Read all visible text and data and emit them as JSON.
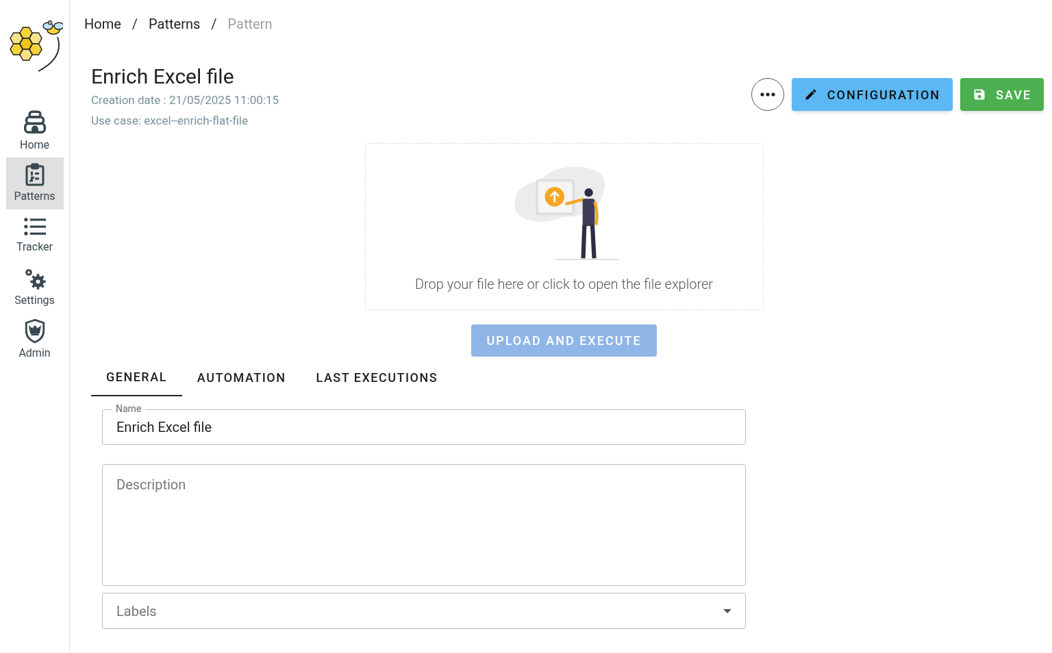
{
  "sidebar": {
    "items": [
      {
        "kind": "hive",
        "label": "Home",
        "selected": false
      },
      {
        "kind": "clipboard",
        "label": "Patterns",
        "selected": true
      },
      {
        "kind": "list",
        "label": "Tracker",
        "selected": false
      },
      {
        "kind": "gears",
        "label": "Settings",
        "selected": false
      },
      {
        "kind": "shield",
        "label": "Admin",
        "selected": false
      }
    ]
  },
  "breadcrumb": [
    {
      "label": "Home",
      "current": false
    },
    {
      "label": "Patterns",
      "current": false
    },
    {
      "label": "Pattern",
      "current": true
    }
  ],
  "separator": "/",
  "header": {
    "title": "Enrich Excel file",
    "creation_date": "Creation date : 21/05/2025 11:00:15",
    "use_case": "Use case: excel--enrich-flat-file",
    "buttons": [
      {
        "kind": "configure",
        "label": "CONFIGURATION"
      },
      {
        "kind": "save",
        "label": "SAVE"
      }
    ]
  },
  "dropzone": {
    "text": "Drop your file here or click to open the file explorer"
  },
  "upload_button": {
    "label": "UPLOAD AND EXECUTE",
    "disabled": true
  },
  "tabs": [
    {
      "label": "GENERAL",
      "selected": true
    },
    {
      "label": "AUTOMATION",
      "selected": false
    },
    {
      "label": "LAST EXECUTIONS",
      "selected": false
    }
  ],
  "form": {
    "name": {
      "label": "Name",
      "value": "Enrich Excel file"
    },
    "description": {
      "placeholder": "Description"
    },
    "labels": {
      "placeholder": "Labels"
    }
  }
}
